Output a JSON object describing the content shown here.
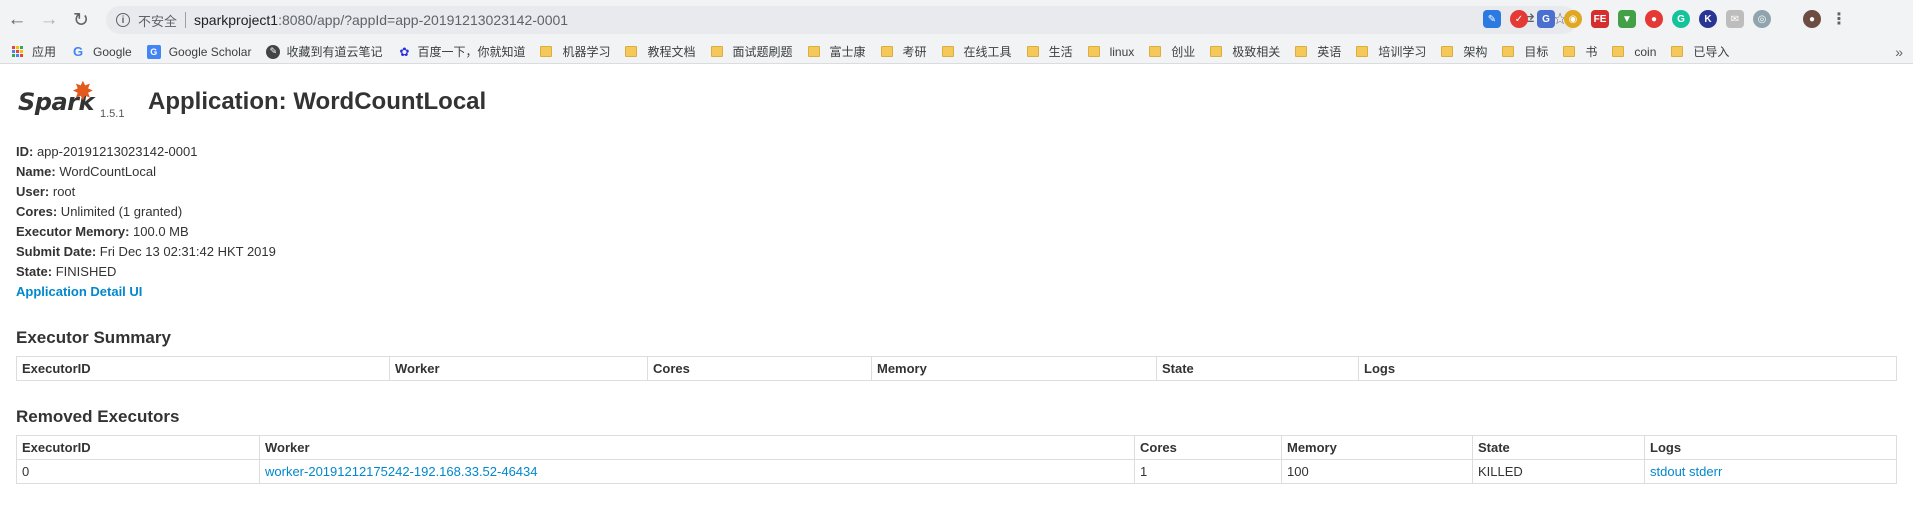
{
  "browser": {
    "back_icon": "arrow-left-icon",
    "forward_icon": "arrow-right-icon",
    "reload_icon": "reload-icon",
    "security_text": "不安全",
    "url_host": "sparkproject1",
    "url_rest": ":8080/app/?appId=app-20191213023142-0001",
    "translate_icon": "translate-icon",
    "star_icon": "star-icon"
  },
  "bookmarks": [
    {
      "label": "应用",
      "icon": "apps-icon"
    },
    {
      "label": "Google",
      "icon": "google-icon"
    },
    {
      "label": "Google Scholar",
      "icon": "google-scholar-icon"
    },
    {
      "label": "收藏到有道云笔记",
      "icon": "youdao-icon"
    },
    {
      "label": "百度一下，你就知道",
      "icon": "baidu-icon"
    },
    {
      "label": "机器学习",
      "icon": "folder-icon"
    },
    {
      "label": "教程文档",
      "icon": "folder-icon"
    },
    {
      "label": "面试题刷题",
      "icon": "folder-icon"
    },
    {
      "label": "富士康",
      "icon": "folder-icon"
    },
    {
      "label": "考研",
      "icon": "folder-icon"
    },
    {
      "label": "在线工具",
      "icon": "folder-icon"
    },
    {
      "label": "生活",
      "icon": "folder-icon"
    },
    {
      "label": "linux",
      "icon": "folder-icon"
    },
    {
      "label": "创业",
      "icon": "folder-icon"
    },
    {
      "label": "极致相关",
      "icon": "folder-icon"
    },
    {
      "label": "英语",
      "icon": "folder-icon"
    },
    {
      "label": "培训学习",
      "icon": "folder-icon"
    },
    {
      "label": "架构",
      "icon": "folder-icon"
    },
    {
      "label": "目标",
      "icon": "folder-icon"
    },
    {
      "label": "书",
      "icon": "folder-icon"
    },
    {
      "label": "coin",
      "icon": "folder-icon"
    },
    {
      "label": "已导入",
      "icon": "folder-icon"
    }
  ],
  "bookmarks_more": "»",
  "page": {
    "logo_text": "Spark",
    "version": "1.5.1",
    "title": "Application: WordCountLocal",
    "info": [
      {
        "label": "ID:",
        "value": " app-20191213023142-0001"
      },
      {
        "label": "Name:",
        "value": " WordCountLocal"
      },
      {
        "label": "User:",
        "value": " root"
      },
      {
        "label": "Cores:",
        "value": " Unlimited (1 granted)"
      },
      {
        "label": "Executor Memory:",
        "value": " 100.0 MB"
      },
      {
        "label": "Submit Date:",
        "value": " Fri Dec 13 02:31:42 HKT 2019"
      },
      {
        "label": "State:",
        "value": " FINISHED"
      }
    ],
    "detail_link": "Application Detail UI"
  },
  "executor_summary": {
    "heading": "Executor Summary",
    "columns": [
      "ExecutorID",
      "Worker",
      "Cores",
      "Memory",
      "State",
      "Logs"
    ]
  },
  "removed_executors": {
    "heading": "Removed Executors",
    "columns": [
      "ExecutorID",
      "Worker",
      "Cores",
      "Memory",
      "State",
      "Logs"
    ],
    "rows": [
      {
        "id": "0",
        "worker": "worker-20191212175242-192.168.33.52-46434",
        "cores": "1",
        "memory": "100",
        "state": "KILLED",
        "stdout": "stdout",
        "stderr": "stderr"
      }
    ]
  },
  "colors": {
    "link": "#0088cc",
    "spark_orange": "#e25a1c"
  }
}
